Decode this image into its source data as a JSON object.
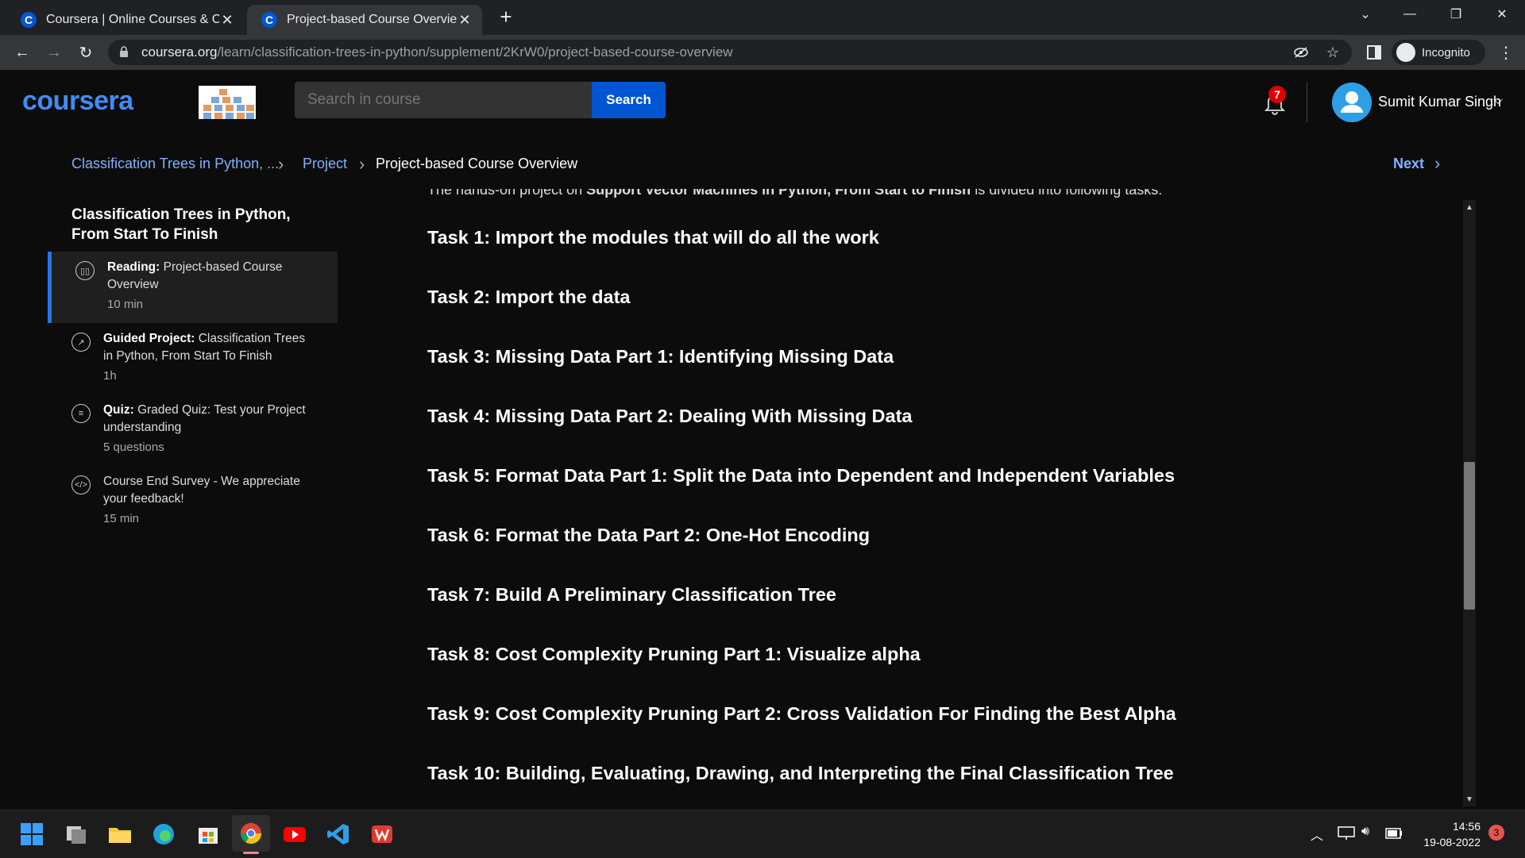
{
  "browser": {
    "tabs": [
      {
        "title": "Coursera | Online Courses & Cre",
        "active": false
      },
      {
        "title": "Project-based Course Overview |",
        "active": true
      }
    ],
    "url_host": "coursera.org",
    "url_path": "/learn/classification-trees-in-python/supplement/2KrW0/project-based-course-overview",
    "incognito_label": "Incognito"
  },
  "header": {
    "logo": "coursera",
    "search_placeholder": "Search in course",
    "search_button": "Search",
    "notification_count": "7",
    "user_name": "Sumit Kumar Singh"
  },
  "breadcrumb": {
    "course": "Classification Trees in Python, ...",
    "section": "Project",
    "current": "Project-based Course Overview",
    "next": "Next"
  },
  "sidebar": {
    "course_title": "Classification Trees in Python, From Start To Finish",
    "items": [
      {
        "type": "Reading:",
        "title": "Project-based Course Overview",
        "meta": "10 min",
        "icon": "book-icon"
      },
      {
        "type": "Guided Project:",
        "title": "Classification Trees in Python, From Start To Finish",
        "meta": "1h",
        "icon": "external-link-icon"
      },
      {
        "type": "Quiz:",
        "title": "Graded Quiz: Test your Project understanding",
        "meta": "5 questions",
        "icon": "quiz-icon"
      },
      {
        "type": "",
        "title": "Course End Survey - We appreciate your feedback!",
        "meta": "15 min",
        "icon": "code-icon"
      }
    ]
  },
  "main": {
    "intro_start": "The hands-on project on ",
    "intro_bold": "Support Vector Machines in Python, From Start to Finish",
    "intro_end": " is divided into following tasks:",
    "tasks": [
      "Task 1: Import the modules that will do all the work",
      "Task 2: Import the data",
      "Task 3: Missing Data Part 1: Identifying Missing Data",
      "Task 4: Missing Data Part 2: Dealing With Missing Data",
      "Task 5: Format Data Part 1: Split the Data into Dependent and Independent Variables",
      "Task 6: Format the Data Part 2: One-Hot Encoding",
      "Task 7: Build A Preliminary Classification Tree",
      "Task 8: Cost Complexity Pruning Part 1: Visualize alpha",
      "Task 9: Cost Complexity Pruning Part 2: Cross Validation For Finding the Best Alpha",
      "Task 10: Building, Evaluating, Drawing, and Interpreting the Final Classification Tree"
    ]
  },
  "taskbar": {
    "time": "14:56",
    "date": "19-08-2022",
    "notification_count": "3"
  },
  "colors": {
    "accent": "#0056d2",
    "link": "#7fb2ff",
    "background": "#0c0c0c"
  }
}
